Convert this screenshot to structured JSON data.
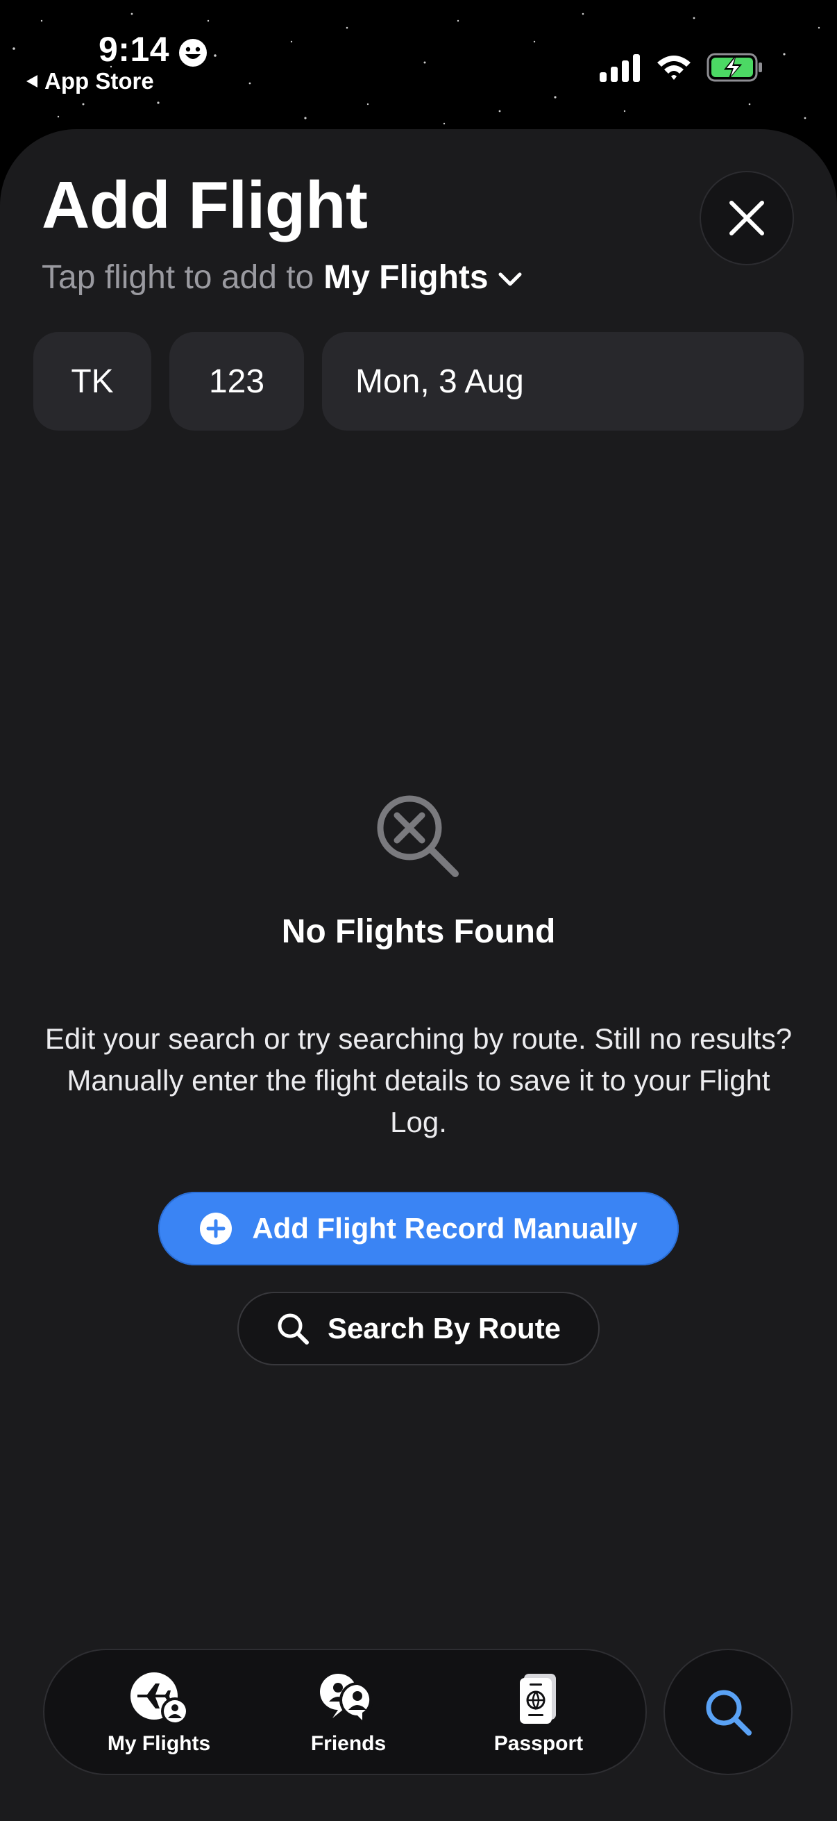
{
  "status_bar": {
    "time": "9:14",
    "back_app": "App Store"
  },
  "header": {
    "title": "Add Flight",
    "subtitle_prefix": "Tap flight to add to",
    "subtitle_target": "My Flights"
  },
  "search": {
    "airline_code": "TK",
    "flight_number": "123",
    "date": "Mon, 3 Aug"
  },
  "empty_state": {
    "title": "No Flights Found",
    "description": "Edit your search or try searching by route. Still no results? Manually enter the flight details to save it to your Flight Log.",
    "primary_action": "Add Flight Record Manually",
    "secondary_action": "Search By Route"
  },
  "tab_bar": {
    "tabs": [
      {
        "label": "My Flights",
        "icon": "plane-person-icon"
      },
      {
        "label": "Friends",
        "icon": "friends-icon"
      },
      {
        "label": "Passport",
        "icon": "passport-icon"
      }
    ]
  },
  "colors": {
    "accent": "#3a84f4",
    "sheet_background": "#1b1b1d",
    "battery": "#4cd964",
    "search_fab_icon": "#5aa2f5"
  }
}
